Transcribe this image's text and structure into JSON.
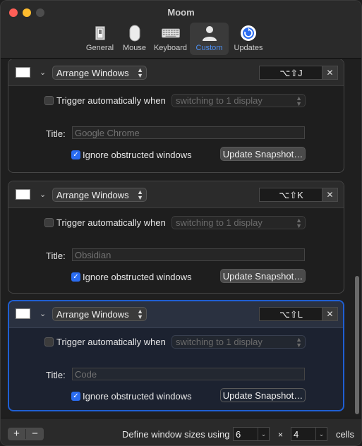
{
  "window": {
    "title": "Moom"
  },
  "toolbar": {
    "items": [
      {
        "label": "General",
        "icon": "general-switch-icon"
      },
      {
        "label": "Mouse",
        "icon": "mouse-icon"
      },
      {
        "label": "Keyboard",
        "icon": "keyboard-icon"
      },
      {
        "label": "Custom",
        "icon": "person-icon",
        "active": true
      },
      {
        "label": "Updates",
        "icon": "refresh-icon"
      }
    ],
    "accent_color": "#4e92f7"
  },
  "cards": [
    {
      "action": "Arrange Windows",
      "shortcut": "⌥⇧J",
      "clear": "✕",
      "trigger_label": "Trigger automatically when",
      "trigger_checked": false,
      "trigger_option": "switching to 1 display",
      "title_label": "Title:",
      "title_placeholder": "Google Chrome",
      "ignore_label": "Ignore obstructed windows",
      "ignore_checked": true,
      "update_label": "Update Snapshot…",
      "selected": false
    },
    {
      "action": "Arrange Windows",
      "shortcut": "⌥⇧K",
      "clear": "✕",
      "trigger_label": "Trigger automatically when",
      "trigger_checked": false,
      "trigger_option": "switching to 1 display",
      "title_label": "Title:",
      "title_placeholder": "Obsidian",
      "ignore_label": "Ignore obstructed windows",
      "ignore_checked": true,
      "update_label": "Update Snapshot…",
      "selected": false
    },
    {
      "action": "Arrange Windows",
      "shortcut": "⌥⇧L",
      "clear": "✕",
      "trigger_label": "Trigger automatically when",
      "trigger_checked": false,
      "trigger_option": "switching to 1 display",
      "title_label": "Title:",
      "title_placeholder": "Code",
      "ignore_label": "Ignore obstructed windows",
      "ignore_checked": true,
      "update_label": "Update Snapshot…",
      "selected": true
    }
  ],
  "bottom": {
    "add": "+",
    "remove": "−",
    "define_label": "Define window sizes using",
    "columns": "6",
    "times": "×",
    "rows": "4",
    "cells_label": "cells"
  },
  "colors": {
    "selection_border": "#1f5fd3",
    "checkbox_checked": "#2a6cf0"
  }
}
